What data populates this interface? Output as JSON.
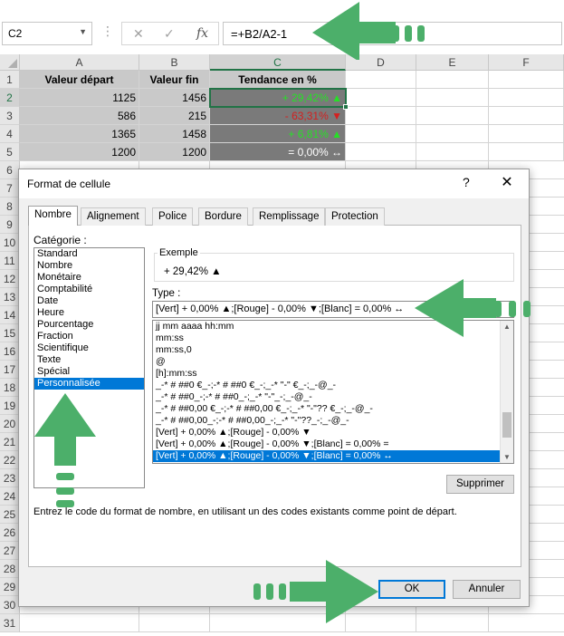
{
  "name_box": {
    "value": "C2",
    "dropdown_icon": "chevron-down-icon"
  },
  "formula_bar": {
    "separator": "⋮",
    "cancel_glyph": "✕",
    "enter_glyph": "✓",
    "function_glyph": "fx",
    "formula": "=+B2/A2-1"
  },
  "columns": [
    "A",
    "B",
    "C",
    "D",
    "E",
    "F"
  ],
  "rows": [
    "1",
    "2",
    "3",
    "4",
    "5",
    "6",
    "7",
    "8",
    "9",
    "10",
    "11",
    "12",
    "13",
    "14",
    "15",
    "16",
    "17",
    "18",
    "19",
    "20",
    "21",
    "22",
    "23",
    "24",
    "25",
    "26",
    "27",
    "28",
    "29",
    "30",
    "31"
  ],
  "table": {
    "headers": [
      "Valeur départ",
      "Valeur fin",
      "Tendance en %"
    ],
    "data": [
      {
        "a": "1125",
        "b": "1456",
        "c": "+ 29,42% ▲"
      },
      {
        "a": "586",
        "b": "215",
        "c": "- 63,31% ▼"
      },
      {
        "a": "1365",
        "b": "1458",
        "c": "+ 6,81% ▲"
      },
      {
        "a": "1200",
        "b": "1200",
        "c": "= 0,00% ↔"
      }
    ]
  },
  "dialog": {
    "title": "Format de cellule",
    "help": "?",
    "close": "✕",
    "tabs": [
      "Nombre",
      "Alignement",
      "Police",
      "Bordure",
      "Remplissage",
      "Protection"
    ],
    "category_label": "Catégorie :",
    "categories": [
      "Standard",
      "Nombre",
      "Monétaire",
      "Comptabilité",
      "Date",
      "Heure",
      "Pourcentage",
      "Fraction",
      "Scientifique",
      "Texte",
      "Spécial",
      "Personnalisée"
    ],
    "selected_category": "Personnalisée",
    "sample_label": "Exemple",
    "sample_value": "+ 29,42% ▲",
    "type_label": "Type :",
    "type_value": "[Vert] + 0,00% ▲;[Rouge] - 0,00% ▼;[Blanc] = 0,00% ↔",
    "type_list": [
      "jj mm aaaa hh:mm",
      "mm:ss",
      "mm:ss,0",
      "@",
      "[h]:mm:ss",
      "_-* # ##0 €_-;-* # ##0 €_-;_-* \"-\" €_-;_-@_-",
      "_-* # ##0_-;-* # ##0_-;_-* \"-\"_-;_-@_-",
      "_-* # ##0,00 €_-;-* # ##0,00 €_-;_-* \"-\"?? €_-;_-@_-",
      "_-* # ##0,00_-;-* # ##0,00_-;_-* \"-\"??_-;_-@_-",
      "[Vert] + 0,00% ▲;[Rouge] - 0,00% ▼",
      "[Vert] + 0,00% ▲;[Rouge] - 0,00% ▼;[Blanc] = 0,00% =",
      "[Vert] + 0,00% ▲;[Rouge] - 0,00% ▼;[Blanc] = 0,00% ↔"
    ],
    "delete_button": "Supprimer",
    "hint": "Entrez le code du format de nombre, en utilisant un des codes existants comme point de départ.",
    "ok_button": "OK",
    "cancel_button": "Annuler"
  },
  "colors": {
    "accent_green": "#217346",
    "annotation_green": "#4caf6a",
    "selection_blue": "#0078d7",
    "positive": "#26e026",
    "negative": "#d42020"
  }
}
